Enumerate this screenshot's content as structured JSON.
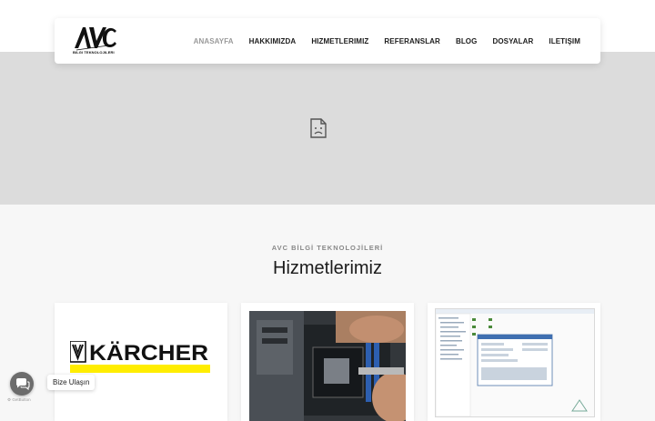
{
  "header": {
    "logo_text": "AVC",
    "logo_subtext": "BILGI TEKNOLOJILERI",
    "nav": [
      {
        "label": "ANASAYFA"
      },
      {
        "label": "HAKKIMIZDA"
      },
      {
        "label": "HIZMETLERIMIZ"
      },
      {
        "label": "REFERANSLAR"
      },
      {
        "label": "BLOG"
      },
      {
        "label": "DOSYALAR"
      },
      {
        "label": "ILETIŞIM"
      }
    ],
    "active_nav": "ANASAYFA"
  },
  "hero": {
    "image_icon": "broken-image-icon"
  },
  "services": {
    "eyebrow": "AVC BİLGİ TEKNOLOJİLERİ",
    "title": "Hizmetlerimiz",
    "cards": [
      {
        "image": "karcher-logo",
        "logo_text": "KÄRCHER"
      },
      {
        "image": "motherboard-repair-photo"
      },
      {
        "image": "software-window-screenshot"
      }
    ]
  },
  "widget": {
    "label": "Bize Ulaşın",
    "icon": "chat-bubbles-icon",
    "credit": "GetButton"
  },
  "colors": {
    "hero_bg": "#dcdcdc",
    "nav_active": "#9a9a9a",
    "karcher_yellow": "#ffed00",
    "widget_gray": "#6c6c6c"
  }
}
